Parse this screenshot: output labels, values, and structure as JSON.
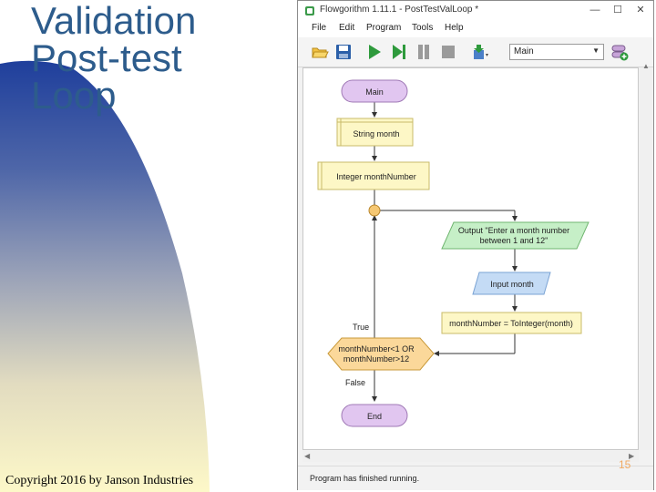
{
  "slide": {
    "title_lines": [
      "Validation",
      "Post-test",
      "Loop"
    ],
    "copyright": "Copyright 2016 by Janson Industries",
    "page_number": "15"
  },
  "window": {
    "title": "Flowgorithm 1.11.1 - PostTestValLoop *",
    "controls": {
      "minimize": "—",
      "maximize": "☐",
      "close": "✕"
    }
  },
  "menu": [
    "File",
    "Edit",
    "Program",
    "Tools",
    "Help"
  ],
  "toolbar": {
    "function_select": "Main",
    "buttons": [
      "open-folder",
      "save",
      "run",
      "step",
      "pause",
      "stop",
      "variable-watch",
      "add-function"
    ]
  },
  "flowchart": {
    "start": "Main",
    "declare_1": "String month",
    "declare_2": "Integer monthNumber",
    "output_1": "Output \"Enter a month number",
    "output_2": "between 1 and 12\"",
    "input": "Input month",
    "assign": "monthNumber = ToInteger(month)",
    "condition_1": "monthNumber<1 OR",
    "condition_2": "monthNumber>12",
    "true_label": "True",
    "false_label": "False",
    "end": "End"
  },
  "status": "Program has finished running."
}
